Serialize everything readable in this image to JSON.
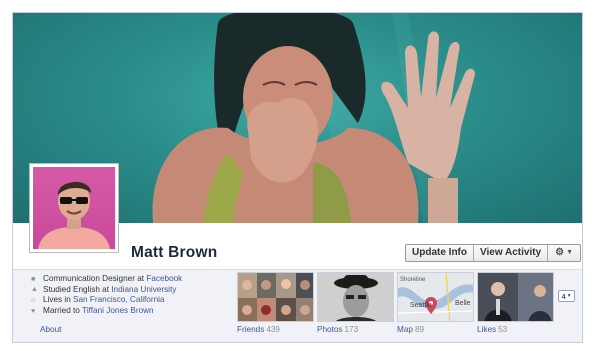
{
  "profile": {
    "name": "Matt Brown"
  },
  "actions": {
    "update_info": "Update Info",
    "view_activity": "View Activity"
  },
  "about": {
    "work_prefix": "Communication Designer at ",
    "work_link": "Facebook",
    "study_prefix": "Studied English at ",
    "study_link": "Indiana University",
    "lives_prefix": "Lives in ",
    "lives_link": "San Francisco, California",
    "married_prefix": "Married to ",
    "married_link": "Tiffani Jones Brown",
    "about_link": "About"
  },
  "apps": [
    {
      "label": "Friends",
      "count": "439"
    },
    {
      "label": "Photos",
      "count": "173"
    },
    {
      "label": "Map",
      "count": "89"
    },
    {
      "label": "Likes",
      "count": "53"
    }
  ],
  "map_labels": {
    "top": "Shoreline",
    "city": "Seattle",
    "side": "Belle"
  },
  "more_apps_count": "4",
  "colors": {
    "link": "#3b5998",
    "cover_water": "#2a8d8a",
    "avatar_bg": "#d65aa8"
  }
}
